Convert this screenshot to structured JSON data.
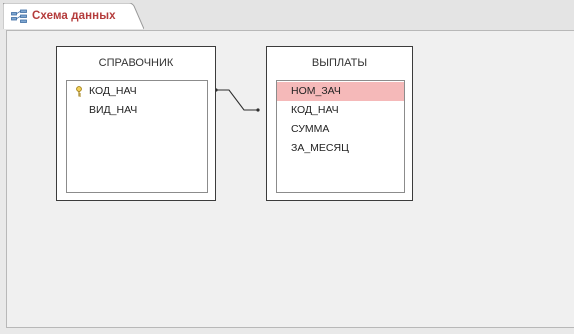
{
  "tab": {
    "label": "Схема данных",
    "icon": "relationships-icon"
  },
  "tables": [
    {
      "title": "СПРАВОЧНИК",
      "fields": [
        {
          "name": "КОД_НАЧ",
          "primary_key": true
        },
        {
          "name": "ВИД_НАЧ",
          "primary_key": false
        }
      ]
    },
    {
      "title": "ВЫПЛАТЫ",
      "fields": [
        {
          "name": "НОМ_ЗАЧ",
          "selected": true
        },
        {
          "name": "КОД_НАЧ"
        },
        {
          "name": "СУММА"
        },
        {
          "name": "ЗА_МЕСЯЦ"
        }
      ]
    }
  ],
  "colors": {
    "selected_field": "#f5b9b9",
    "tab_label": "#b43b3b"
  }
}
